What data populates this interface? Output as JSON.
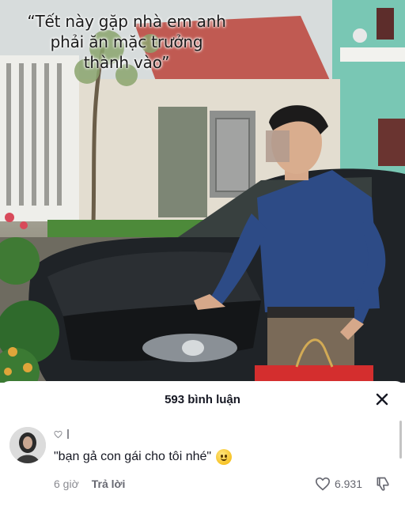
{
  "video": {
    "caption_lines": [
      "“Tết này gặp nhà em anh",
      "phải ăn mặc trưởng",
      "thành vào”"
    ]
  },
  "comments_panel": {
    "header": "593 bình luận",
    "close_icon": "close-icon",
    "comment": {
      "text": "\"bạn gả con gái cho tôi nhé\"",
      "emoji": "smile-emoji",
      "time": "6 giờ",
      "reply_label": "Trả lời",
      "like_count": "6.931",
      "like_icon": "heart-outline-icon",
      "dislike_icon": "thumbs-down-icon"
    }
  },
  "colors": {
    "text_primary": "#161823",
    "text_secondary": "#8a8b91",
    "sheet_bg": "#ffffff"
  }
}
